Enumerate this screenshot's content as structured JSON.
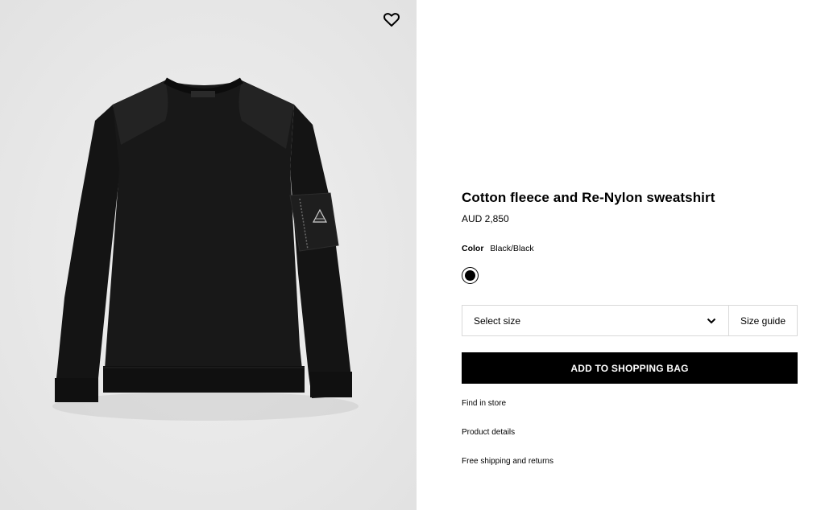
{
  "wishlist": {
    "icon": "heart-icon"
  },
  "product": {
    "title": "Cotton fleece and Re-Nylon sweatshirt",
    "price": "AUD 2,850",
    "color_label": "Color",
    "color_value": "Black/Black",
    "swatch_color": "#000000",
    "size_select_label": "Select size",
    "size_guide_label": "Size guide",
    "add_to_bag_label": "ADD TO SHOPPING BAG",
    "links": [
      "Find in store",
      "Product details",
      "Free shipping and returns"
    ]
  },
  "colors": {
    "gallery_background": "#e8e8e8",
    "button_background": "#000000",
    "button_text": "#ffffff",
    "border": "#d8d8d8"
  }
}
